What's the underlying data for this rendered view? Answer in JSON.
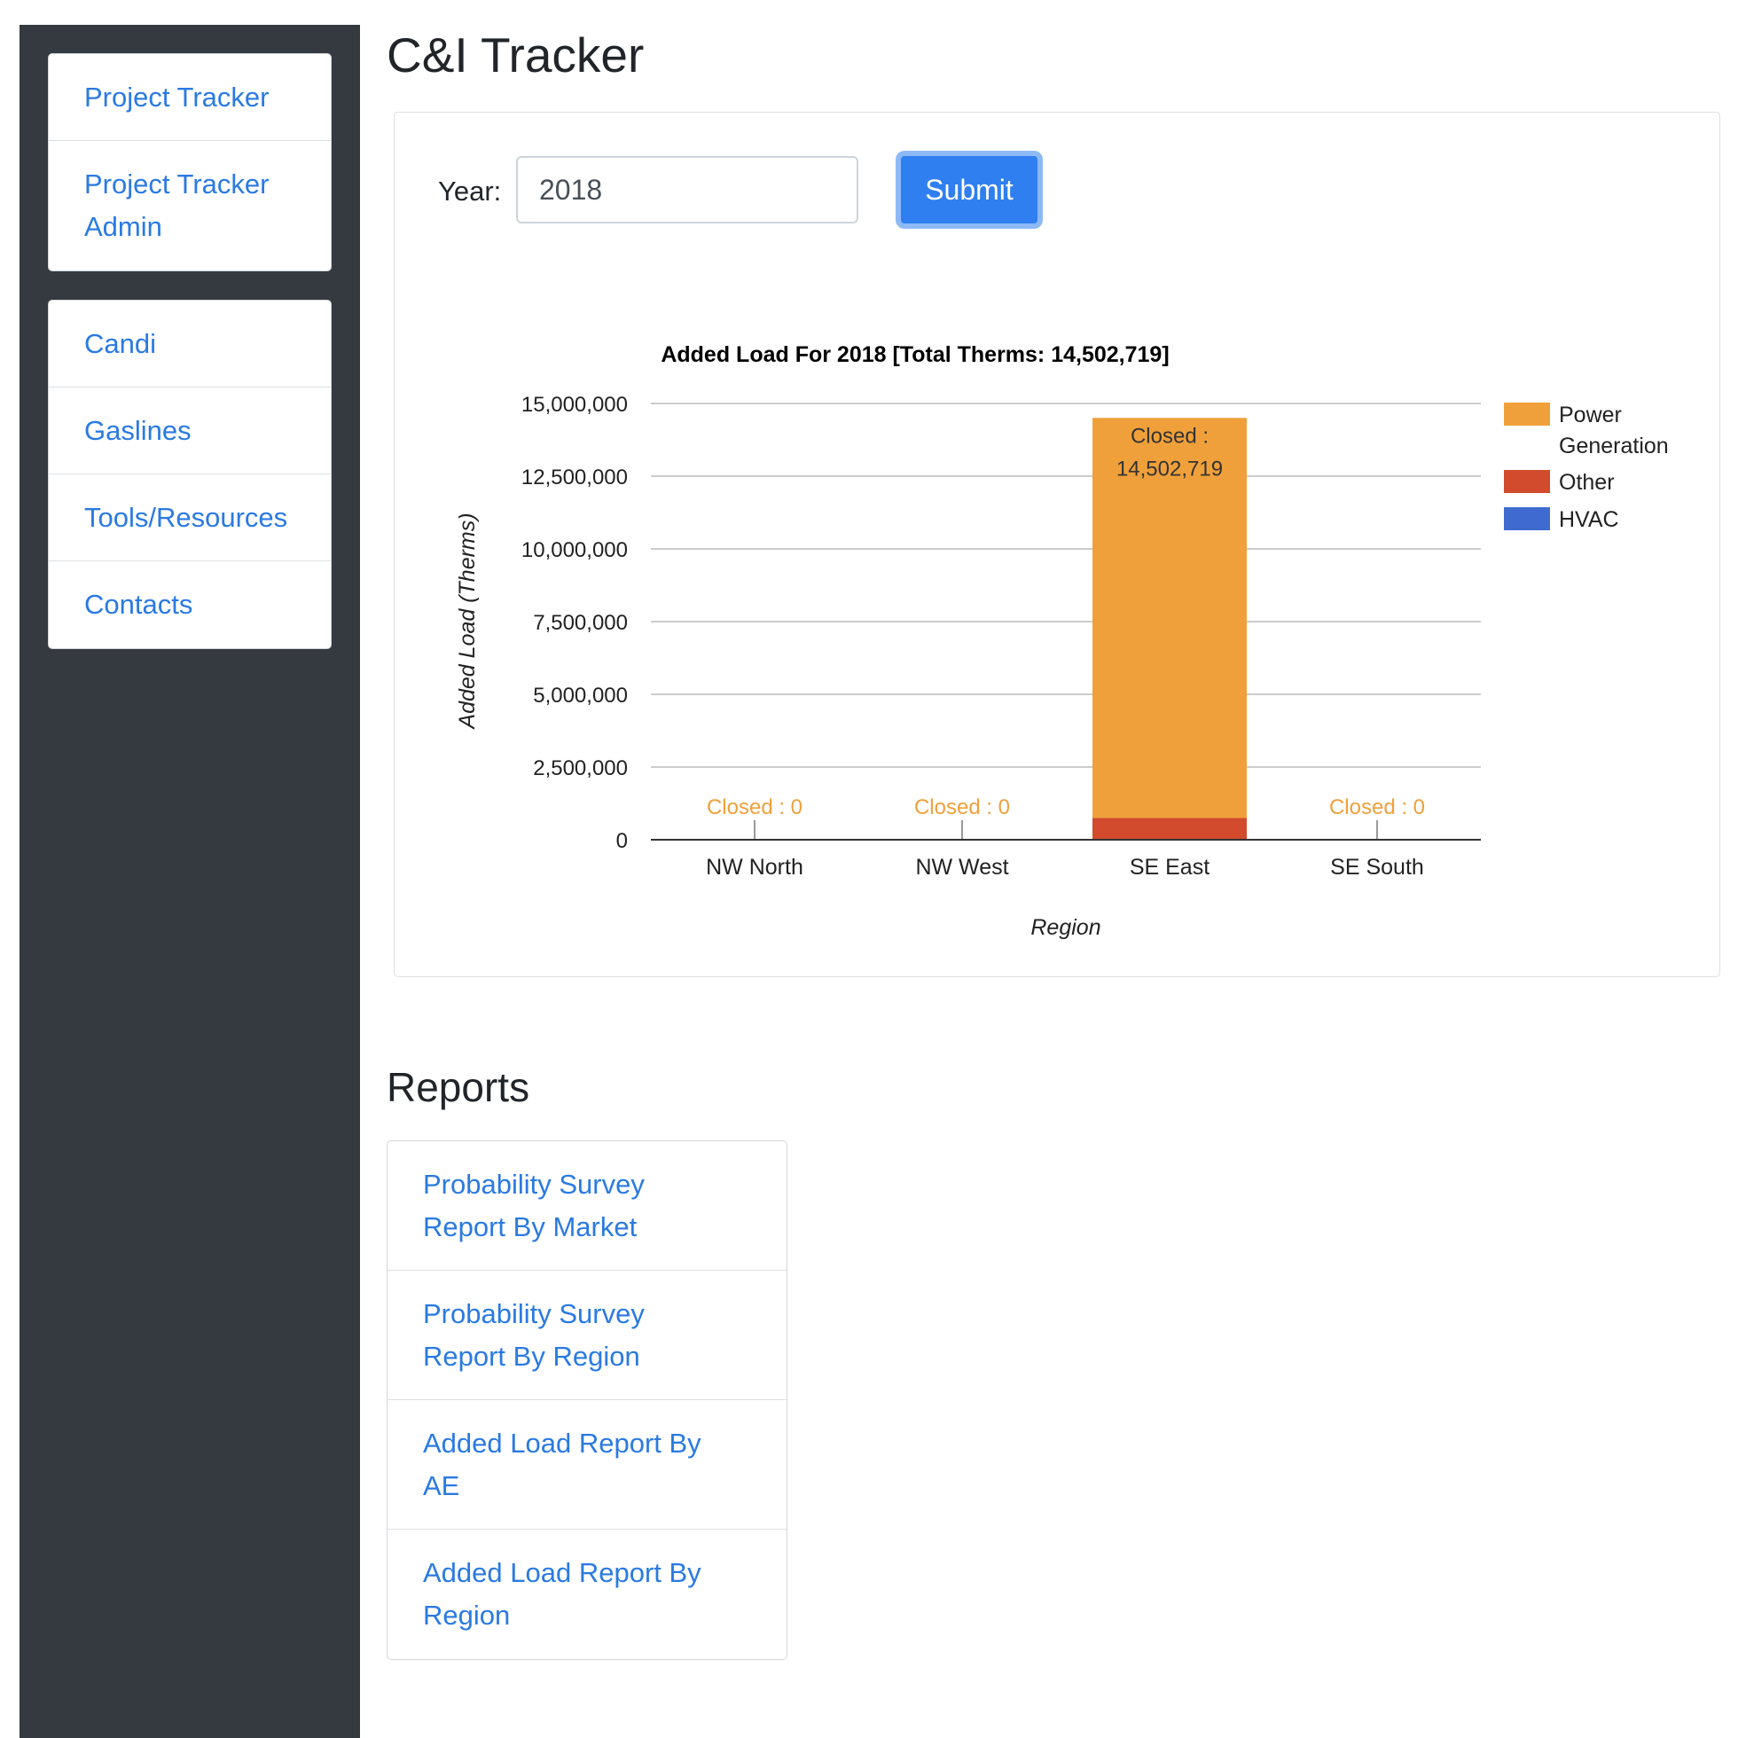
{
  "sidebar": {
    "group1": [
      {
        "label": "Project Tracker"
      },
      {
        "label": "Project Tracker Admin"
      }
    ],
    "group2": [
      {
        "label": "Candi"
      },
      {
        "label": "Gaslines"
      },
      {
        "label": "Tools/Resources"
      },
      {
        "label": "Contacts"
      }
    ]
  },
  "page": {
    "title": "C&I Tracker"
  },
  "form": {
    "year_label": "Year:",
    "year_value": "2018",
    "submit_label": "Submit"
  },
  "chart_data": {
    "type": "bar",
    "stacked": true,
    "title": "Added Load For 2018 [Total Therms: 14,502,719]",
    "xlabel": "Region",
    "ylabel": "Added Load (Therms)",
    "ylim": [
      0,
      15000000
    ],
    "yticks": [
      0,
      2500000,
      5000000,
      7500000,
      10000000,
      12500000,
      15000000
    ],
    "ytick_labels": [
      "0",
      "2,500,000",
      "5,000,000",
      "7,500,000",
      "10,000,000",
      "12,500,000",
      "15,000,000"
    ],
    "categories": [
      "NW North",
      "NW West",
      "SE East",
      "SE South"
    ],
    "series": [
      {
        "name": "HVAC",
        "color": "#3f6bd0",
        "values": [
          0,
          0,
          0,
          0
        ]
      },
      {
        "name": "Other",
        "color": "#d14b2c",
        "values": [
          0,
          0,
          750000,
          0
        ]
      },
      {
        "name": "Power Generation",
        "color": "#f0a03a",
        "values": [
          0,
          0,
          13752719,
          0
        ]
      }
    ],
    "legend": {
      "placement": "right",
      "entries": [
        {
          "label": "Power Generation",
          "color": "#f0a03a"
        },
        {
          "label": "Other",
          "color": "#d14b2c"
        },
        {
          "label": "HVAC",
          "color": "#3f6bd0"
        }
      ]
    },
    "annotations": [
      {
        "category": "NW North",
        "prefix": "Closed :",
        "value": "0"
      },
      {
        "category": "NW West",
        "prefix": "Closed :",
        "value": "0"
      },
      {
        "category": "SE East",
        "prefix": "Closed :",
        "value": "14,502,719"
      },
      {
        "category": "SE South",
        "prefix": "Closed :",
        "value": "0"
      }
    ],
    "grid": true
  },
  "reports": {
    "title": "Reports",
    "items": [
      {
        "label": "Probability Survey Report By Market"
      },
      {
        "label": "Probability Survey Report By Region"
      },
      {
        "label": "Added Load Report By AE"
      },
      {
        "label": "Added Load Report By Region"
      }
    ]
  }
}
